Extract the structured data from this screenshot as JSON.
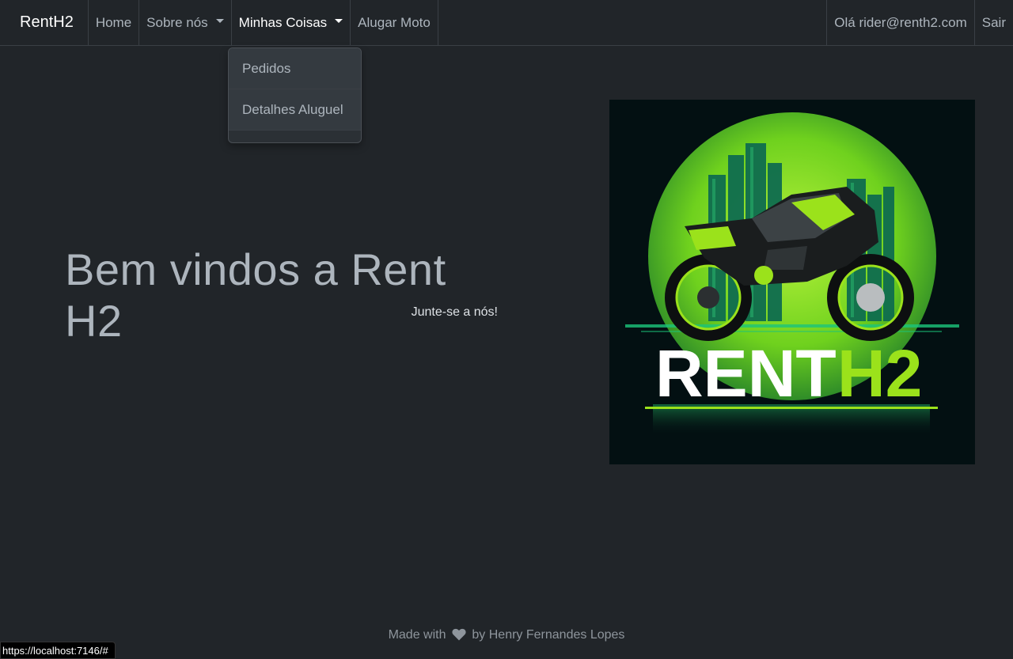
{
  "navbar": {
    "brand": "RentH2",
    "items": [
      {
        "label": "Home"
      },
      {
        "label": "Sobre nós"
      },
      {
        "label": "Minhas Coisas"
      },
      {
        "label": "Alugar Moto"
      }
    ],
    "greeting": "Olá rider@renth2.com",
    "logout": "Sair"
  },
  "dropdown": {
    "items": [
      "Pedidos",
      "Detalhes Aluguel"
    ]
  },
  "hero": {
    "title": "Bem vindos a Rent H2",
    "subtitle": "Junte-se a nós!"
  },
  "logo": {
    "text_main": "RENT",
    "text_accent": "H2",
    "accent_color": "#9be21b"
  },
  "footer": {
    "prefix": "Made with",
    "suffix": "by Henry Fernandes Lopes"
  },
  "status_bar": {
    "url": "https://localhost:7146/#"
  },
  "colors": {
    "background": "#212529",
    "accent_green": "#9be21b"
  }
}
